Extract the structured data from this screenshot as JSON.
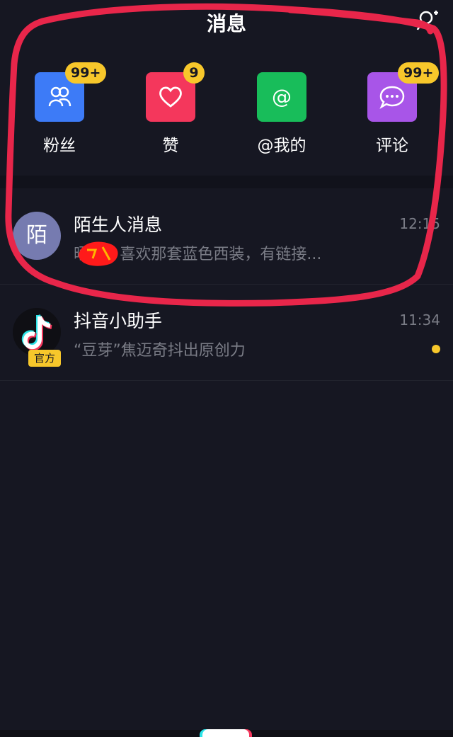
{
  "header": {
    "title": "消息",
    "add_friend_icon": "add-friend-icon"
  },
  "quick_actions": [
    {
      "label": "粉丝",
      "badge": "99+",
      "icon": "fans-icon",
      "color": "#3d7bf7"
    },
    {
      "label": "赞",
      "badge": "9",
      "icon": "heart-icon",
      "color": "#f4375c"
    },
    {
      "label": "@我的",
      "badge": "",
      "icon": "at-icon",
      "color": "#18bd5a"
    },
    {
      "label": "评论",
      "badge": "99+",
      "icon": "comment-icon",
      "color": "#a855e8"
    }
  ],
  "messages": [
    {
      "title": "陌生人消息",
      "preview": "晒   花: 喜欢那套蓝色西装，有链接...",
      "time": "12:15",
      "avatar_text": "陌",
      "unread": false
    },
    {
      "title": "抖音小助手",
      "preview": "“豆芽”焦迈奇抖出原创力",
      "time": "11:34",
      "tag": "官方",
      "unread": true
    }
  ],
  "colors": {
    "background": "#161722",
    "badge": "#f7c72b",
    "annotation": "#e8264a"
  }
}
